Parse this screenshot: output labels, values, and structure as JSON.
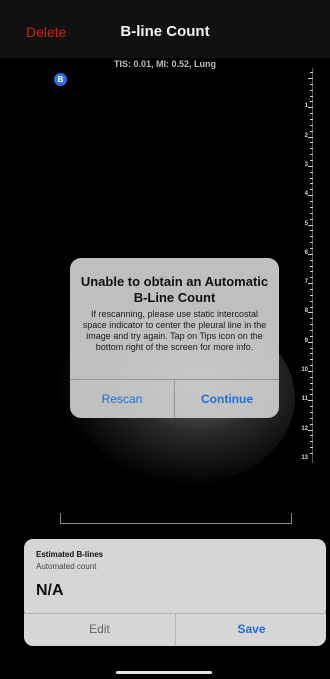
{
  "header": {
    "delete_label": "Delete",
    "title": "B-line Count",
    "scan_info": "TIS: 0.01, MI: 0.52, Lung"
  },
  "badge": {
    "label": "B"
  },
  "ruler": {
    "labels": [
      "1",
      "2",
      "3",
      "4",
      "5",
      "6",
      "7",
      "8",
      "9",
      "10",
      "11",
      "12",
      "13"
    ]
  },
  "dialog": {
    "title": "Unable to obtain an Automatic B-Line Count",
    "message": "If rescanning, please use static intercostal space indicator to center the pleural line in the image and try again. Tap on Tips icon on the bottom right of the screen for more info.",
    "rescan_label": "Rescan",
    "continue_label": "Continue"
  },
  "panel": {
    "title": "Estimated B-lines",
    "subtitle": "Automated count",
    "value": "N/A",
    "edit_label": "Edit",
    "save_label": "Save"
  },
  "colors": {
    "delete": "#c8231b",
    "accent": "#1f6fd6"
  }
}
